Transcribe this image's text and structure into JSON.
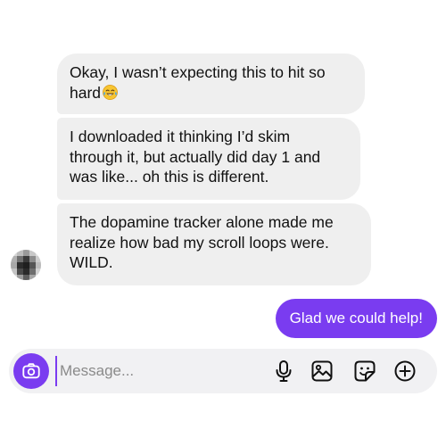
{
  "conversation": {
    "incoming": [
      {
        "text": "Okay, I wasn’t expecting this to hit so\nhard",
        "emoji": "laughing-tears-emoji"
      },
      {
        "text": "I downloaded it thinking I’d skim\nthrough it, but actually did day 1 and\nwas like... oh this is different."
      },
      {
        "text": "The dopamine tracker alone made me\nrealize how bad my scroll loops were.\nWILD."
      }
    ],
    "outgoing": [
      {
        "text": "Glad we could help!"
      }
    ]
  },
  "composer": {
    "placeholder": "Message...",
    "icons": [
      "camera-icon",
      "mic-icon",
      "image-icon",
      "sticker-icon",
      "add-icon"
    ]
  },
  "colors": {
    "accent": "#7a3cf0",
    "incoming_bubble": "#efefef",
    "composer_bg": "#f1f1f3"
  }
}
